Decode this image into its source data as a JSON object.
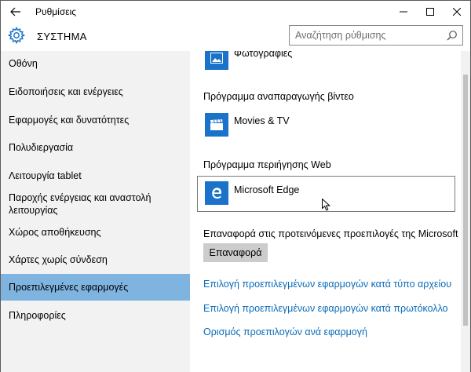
{
  "window": {
    "title": "Ρυθμίσεις"
  },
  "header": {
    "section_title": "ΣΥΣΤΗΜΑ",
    "search_placeholder": "Αναζήτηση ρύθμισης"
  },
  "sidebar": {
    "items": [
      {
        "label": "Οθόνη",
        "selected": false
      },
      {
        "label": "Ειδοποιήσεις και ενέργειες",
        "selected": false
      },
      {
        "label": "Εφαρμογές και δυνατότητες",
        "selected": false
      },
      {
        "label": "Πολυδιεργασία",
        "selected": false
      },
      {
        "label": "Λειτουργία tablet",
        "selected": false
      },
      {
        "label": "Παροχής ενέργειας και αναστολή λειτουργίας",
        "selected": false
      },
      {
        "label": "Χώρος αποθήκευσης",
        "selected": false
      },
      {
        "label": "Χάρτες χωρίς σύνδεση",
        "selected": false
      },
      {
        "label": "Προεπιλεγμένες εφαρμογές",
        "selected": true
      },
      {
        "label": "Πληροφορίες",
        "selected": false
      }
    ]
  },
  "content": {
    "photos_app": "Φωτογραφίες",
    "video_heading": "Πρόγραμμα αναπαραγωγής βίντεο",
    "video_app": "Movies & TV",
    "web_heading": "Πρόγραμμα περιήγησης Web",
    "web_app": "Microsoft Edge",
    "reset_label": "Επαναφορά στις προτεινόμενες προεπιλογές της Microsoft",
    "reset_button": "Επαναφορά",
    "links": [
      "Επιλογή προεπιλεγμένων εφαρμογών κατά τύπο αρχείου",
      "Επιλογή προεπιλεγμένων εφαρμογών κατά πρωτόκολλο",
      "Ορισμός προεπιλογών ανά εφαρμογή"
    ]
  },
  "colors": {
    "accent": "#1a73c8",
    "selected_nav": "#7fb3e0",
    "link": "#0b6bb8",
    "sidebar_bg": "#f2f2f2"
  }
}
